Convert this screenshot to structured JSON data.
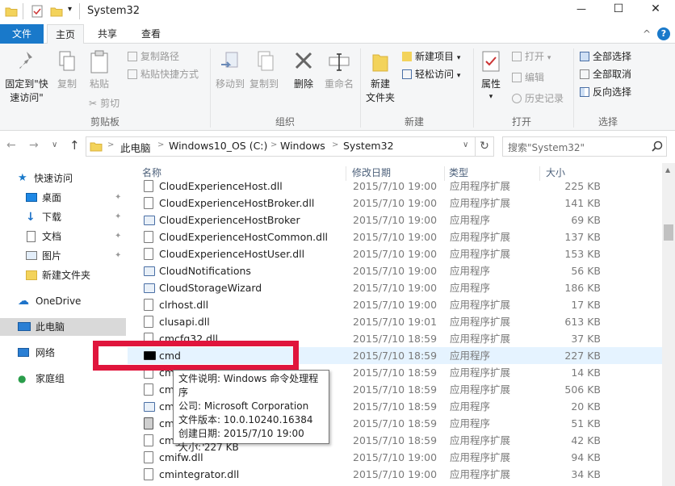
{
  "window": {
    "title": "System32",
    "minimize_glyph": "—",
    "maximize_glyph": "☐",
    "close_glyph": "✕",
    "collapse_ribbon_glyph": "^",
    "help_glyph": "?"
  },
  "tabs": {
    "file": "文件",
    "home": "主页",
    "share": "共享",
    "view": "查看"
  },
  "ribbon": {
    "pin": "固定到\"快速访问\"",
    "copy": "复制",
    "paste": "粘贴",
    "copy_path": "复制路径",
    "paste_shortcut": "粘贴快捷方式",
    "cut": "剪切",
    "clipboard_group": "剪贴板",
    "move_to": "移动到",
    "copy_to": "复制到",
    "delete": "删除",
    "rename": "重命名",
    "organize_group": "组织",
    "new_folder": "新建\n文件夹",
    "new_item": "新建项目",
    "easy_access": "轻松访问",
    "new_group": "新建",
    "properties": "属性",
    "open": "打开",
    "edit": "编辑",
    "history": "历史记录",
    "open_group": "打开",
    "select_all": "全部选择",
    "select_none": "全部取消",
    "invert_selection": "反向选择",
    "select_group": "选择"
  },
  "address_bar": {
    "back_glyph": "←",
    "forward_glyph": "→",
    "recent_glyph": "∨",
    "up_glyph": "↑",
    "path": [
      "此电脑",
      "Windows10_OS (C:)",
      "Windows",
      "System32"
    ],
    "path_sep": ">",
    "refresh_glyph": "↻",
    "search_placeholder": "搜索\"System32\""
  },
  "nav_pane": {
    "quick_access": "快速访问",
    "pinned": [
      {
        "label": "桌面",
        "icon": "desktop-icon"
      },
      {
        "label": "下载",
        "icon": "download-icon"
      },
      {
        "label": "文档",
        "icon": "document-icon"
      },
      {
        "label": "图片",
        "icon": "pictures-icon"
      }
    ],
    "new_folder": "新建文件夹",
    "onedrive": "OneDrive",
    "this_pc": "此电脑",
    "network": "网络",
    "homegroup": "家庭组"
  },
  "columns": {
    "name": "名称",
    "date": "修改日期",
    "type": "类型",
    "size": "大小"
  },
  "files": [
    {
      "name": "CloudExperienceHost.dll",
      "date": "2015/7/10 19:00",
      "type": "应用程序扩展",
      "size": "225 KB",
      "icon": "dll"
    },
    {
      "name": "CloudExperienceHostBroker.dll",
      "date": "2015/7/10 19:00",
      "type": "应用程序扩展",
      "size": "141 KB",
      "icon": "dll"
    },
    {
      "name": "CloudExperienceHostBroker",
      "date": "2015/7/10 19:00",
      "type": "应用程序",
      "size": "69 KB",
      "icon": "exe"
    },
    {
      "name": "CloudExperienceHostCommon.dll",
      "date": "2015/7/10 19:00",
      "type": "应用程序扩展",
      "size": "137 KB",
      "icon": "dll"
    },
    {
      "name": "CloudExperienceHostUser.dll",
      "date": "2015/7/10 19:00",
      "type": "应用程序扩展",
      "size": "153 KB",
      "icon": "dll"
    },
    {
      "name": "CloudNotifications",
      "date": "2015/7/10 19:00",
      "type": "应用程序",
      "size": "56 KB",
      "icon": "exe"
    },
    {
      "name": "CloudStorageWizard",
      "date": "2015/7/10 19:00",
      "type": "应用程序",
      "size": "186 KB",
      "icon": "exe"
    },
    {
      "name": "clrhost.dll",
      "date": "2015/7/10 19:00",
      "type": "应用程序扩展",
      "size": "17 KB",
      "icon": "dll"
    },
    {
      "name": "clusapi.dll",
      "date": "2015/7/10 19:01",
      "type": "应用程序扩展",
      "size": "613 KB",
      "icon": "dll"
    },
    {
      "name": "cmcfg32.dll",
      "date": "2015/7/10 18:59",
      "type": "应用程序扩展",
      "size": "37 KB",
      "icon": "dll"
    },
    {
      "name": "cmd",
      "date": "2015/7/10 18:59",
      "type": "应用程序",
      "size": "227 KB",
      "icon": "cmd"
    },
    {
      "name": "cmdial32.dll",
      "date": "2015/7/10 18:59",
      "type": "应用程序扩展",
      "size": "14 KB",
      "icon": "dll"
    },
    {
      "name": "cmdl32",
      "date": "2015/7/10 18:59",
      "type": "应用程序扩展",
      "size": "506 KB",
      "icon": "dll"
    },
    {
      "name": "cmdkey",
      "date": "2015/7/10 18:59",
      "type": "应用程序",
      "size": "20 KB",
      "icon": "exe"
    },
    {
      "name": "cmdl32",
      "date": "2015/7/10 18:59",
      "type": "应用程序",
      "size": "51 KB",
      "icon": "shield"
    },
    {
      "name": "cmgrcspps.dll",
      "date": "2015/7/10 18:59",
      "type": "应用程序扩展",
      "size": "42 KB",
      "icon": "dll"
    },
    {
      "name": "cmifw.dll",
      "date": "2015/7/10 19:00",
      "type": "应用程序扩展",
      "size": "94 KB",
      "icon": "dll"
    },
    {
      "name": "cmintegrator.dll",
      "date": "2015/7/10 19:00",
      "type": "应用程序扩展",
      "size": "34 KB",
      "icon": "dll"
    }
  ],
  "tooltip": {
    "description": "文件说明: Windows 命令处理程序",
    "company": "公司: Microsoft Corporation",
    "version": "文件版本: 10.0.10240.16384",
    "created": "创建日期: 2015/7/10 19:00",
    "size": "大小: 227 KB"
  },
  "colors": {
    "file_tab": "#1979ca",
    "highlight": "#e0153c",
    "selected_nav": "#cce8ff"
  }
}
